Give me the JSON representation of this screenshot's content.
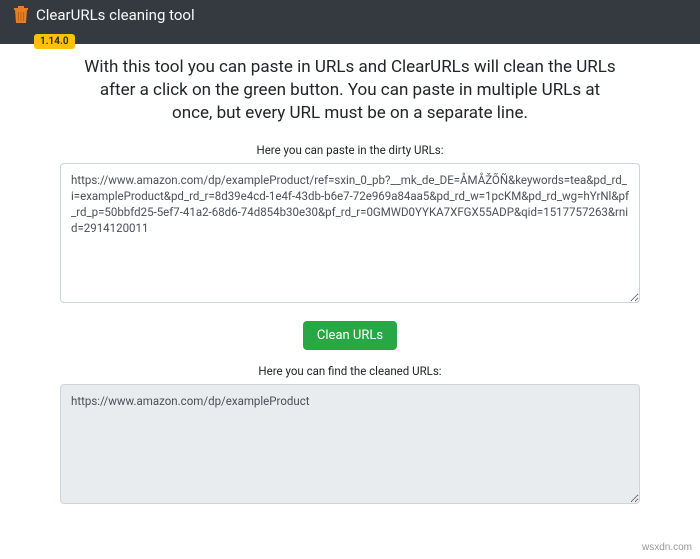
{
  "navbar": {
    "title": "ClearURLs cleaning tool",
    "version": "1.14.0",
    "icon_name": "trash-icon"
  },
  "headline": "With this tool you can paste in URLs and ClearURLs will clean the URLs after a click on the green button. You can paste in multiple URLs at once, but every URL must be on a separate line.",
  "input_section": {
    "label": "Here you can paste in the dirty URLs:",
    "value": "https://www.amazon.com/dp/exampleProduct/ref=sxin_0_pb?__mk_de_DE=ÅMÅŽÕÑ&keywords=tea&pd_rd_i=exampleProduct&pd_rd_r=8d39e4cd-1e4f-43db-b6e7-72e969a84aa5&pd_rd_w=1pcKM&pd_rd_wg=hYrNl&pf_rd_p=50bbfd25-5ef7-41a2-68d6-74d854b30e30&pf_rd_r=0GMWD0YYKA7XFGX55ADP&qid=1517757263&rnid=2914120011"
  },
  "action": {
    "clean_label": "Clean URLs"
  },
  "output_section": {
    "label": "Here you can find the cleaned URLs:",
    "value": "https://www.amazon.com/dp/exampleProduct"
  },
  "watermark": "wsxdn.com",
  "colors": {
    "navbar_bg": "#343a40",
    "badge_bg": "#ffc107",
    "button_bg": "#28a745",
    "output_bg": "#e9ecef"
  }
}
